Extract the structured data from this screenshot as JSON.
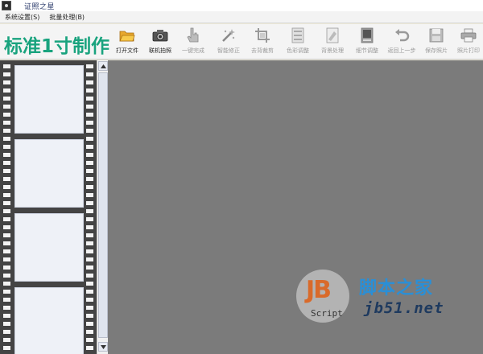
{
  "window": {
    "title": "证照之星"
  },
  "menu": [
    {
      "label": "系统设置(S)"
    },
    {
      "label": "批量处理(B)"
    }
  ],
  "toolbar": {
    "brand": "标准1寸制作",
    "tools": [
      {
        "label": "打开文件",
        "icon": "folder-open-icon",
        "enabled": true
      },
      {
        "label": "联机拍照",
        "icon": "camera-icon",
        "enabled": true
      },
      {
        "label": "一键完成",
        "icon": "hand-pointer-icon",
        "enabled": false
      },
      {
        "label": "智能修正",
        "icon": "magic-wand-icon",
        "enabled": false
      },
      {
        "label": "去背裁剪",
        "icon": "crop-icon",
        "enabled": false
      },
      {
        "label": "色彩调整",
        "icon": "color-adjust-icon",
        "enabled": false
      },
      {
        "label": "背景处理",
        "icon": "background-icon",
        "enabled": false
      },
      {
        "label": "细节调整",
        "icon": "detail-icon",
        "enabled": false
      },
      {
        "label": "返回上一步",
        "icon": "undo-icon",
        "enabled": false
      },
      {
        "label": "保存照片",
        "icon": "save-icon",
        "enabled": false
      },
      {
        "label": "照片打印",
        "icon": "print-icon",
        "enabled": false
      }
    ]
  },
  "filmstrip": {
    "frames": 4
  },
  "watermark": {
    "logo_text": "JB",
    "logo_sub": "Script",
    "cn_text": "脚本之家",
    "url": "jb51.net"
  },
  "colors": {
    "brand": "#19a37e",
    "canvas": "#7b7b7b",
    "film": "#444444",
    "watermark_cn": "#2a8fd6",
    "watermark_logo": "#d96a2a"
  }
}
